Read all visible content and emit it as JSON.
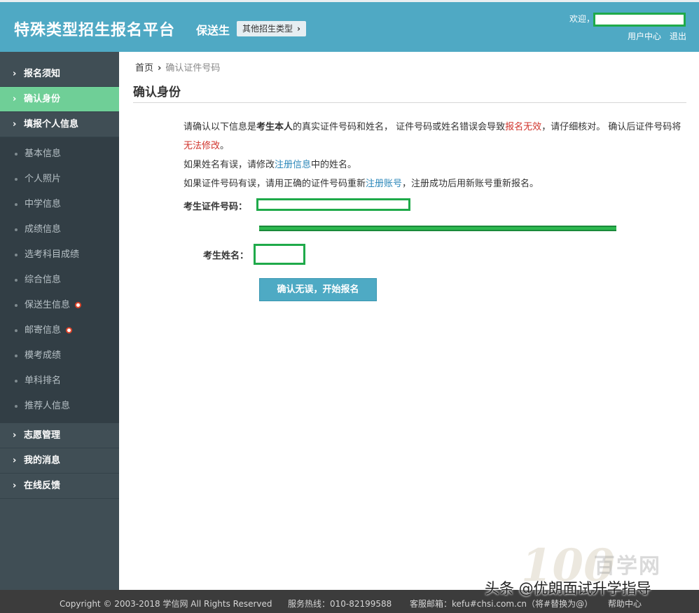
{
  "header": {
    "brand": "特殊类型招生报名平台",
    "sub_type": "保送生",
    "other_types": "其他招生类型",
    "welcome": "欢迎，",
    "user_center": "用户中心",
    "logout": "退出"
  },
  "sidebar": {
    "main_top": [
      {
        "label": "报名须知",
        "active": false
      },
      {
        "label": "确认身份",
        "active": true
      },
      {
        "label": "填报个人信息",
        "active": false
      }
    ],
    "sub_items": [
      {
        "label": "基本信息",
        "badge": false
      },
      {
        "label": "个人照片",
        "badge": false
      },
      {
        "label": "中学信息",
        "badge": false
      },
      {
        "label": "成绩信息",
        "badge": false
      },
      {
        "label": "选考科目成绩",
        "badge": false
      },
      {
        "label": "综合信息",
        "badge": false
      },
      {
        "label": "保送生信息",
        "badge": true
      },
      {
        "label": "邮寄信息",
        "badge": true
      },
      {
        "label": "模考成绩",
        "badge": false
      },
      {
        "label": "单科排名",
        "badge": false
      },
      {
        "label": "推荐人信息",
        "badge": false
      }
    ],
    "main_bottom": [
      {
        "label": "志愿管理"
      },
      {
        "label": "我的消息"
      },
      {
        "label": "在线反馈"
      }
    ]
  },
  "breadcrumb": {
    "home": "首页",
    "current": "确认证件号码"
  },
  "page_title": "确认身份",
  "notice": {
    "p1_a": "请确认以下信息是",
    "p1_bold": "考生本人",
    "p1_b": "的真实证件号码和姓名， 证件号码或姓名错误会导致",
    "p1_red1": "报名无效",
    "p1_c": "，请仔细核对。 确认后证件号码将",
    "p1_red2": "无法修改",
    "p1_d": "。",
    "p2_a": "如果姓名有误，请修改",
    "p2_link": "注册信息",
    "p2_b": "中的姓名。",
    "p3_a": "如果证件号码有误，请用正确的证件号码重新",
    "p3_link": "注册账号",
    "p3_b": "，注册成功后用新账号重新报名。"
  },
  "form": {
    "id_label": "考生证件号码：",
    "name_label": "考生姓名："
  },
  "confirm_button": "确认无误，开始报名",
  "footer": {
    "copyright": "Copyright © 2003-2018 学信网 All Rights Reserved",
    "hotline": "服务热线：010-82199588",
    "email": "客服邮箱：kefu#chsi.com.cn（将#替换为@）",
    "help": "帮助中心"
  },
  "watermark": {
    "logo": "100",
    "site": "百学网",
    "caption": "头条 @优朗面试升学指导"
  },
  "colors": {
    "header_bg": "#4fa9c4",
    "sidebar_bg": "#404e55",
    "active_item": "#6fcf97",
    "button": "#4eaac4",
    "red": "#d0342c",
    "link": "#2b87b9"
  }
}
